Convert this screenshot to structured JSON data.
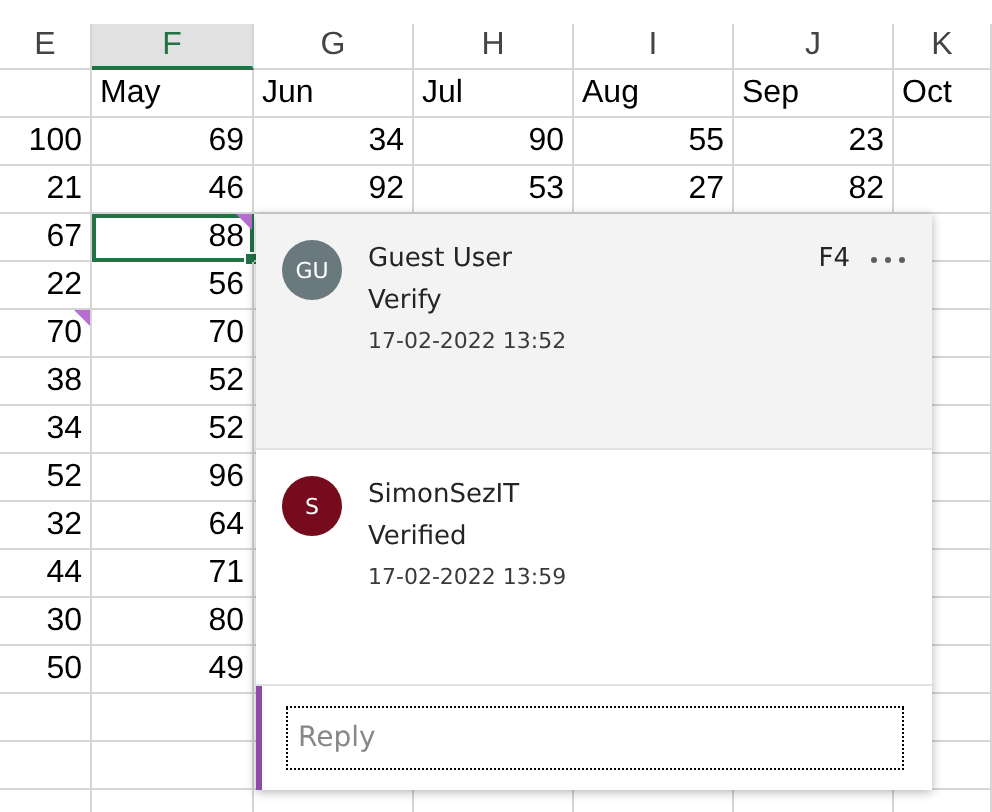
{
  "columns": [
    {
      "letter": "E",
      "selected": false
    },
    {
      "letter": "F",
      "selected": true
    },
    {
      "letter": "G",
      "selected": false
    },
    {
      "letter": "H",
      "selected": false
    },
    {
      "letter": "I",
      "selected": false
    },
    {
      "letter": "J",
      "selected": false
    },
    {
      "letter": "K",
      "selected": false
    }
  ],
  "rows": [
    {
      "kind": "header",
      "cells": [
        null,
        {
          "value": "May",
          "selected": false,
          "comment": false
        },
        {
          "value": "Jun",
          "selected": false,
          "comment": false
        },
        {
          "value": "Jul",
          "selected": false,
          "comment": false
        },
        {
          "value": "Aug",
          "selected": false,
          "comment": false
        },
        {
          "value": "Sep",
          "selected": false,
          "comment": false
        },
        {
          "value": "Oct",
          "selected": false,
          "comment": false
        }
      ]
    },
    {
      "kind": "data",
      "cells": [
        {
          "value": "100",
          "selected": false,
          "comment": false
        },
        {
          "value": "69",
          "selected": false,
          "comment": false
        },
        {
          "value": "34",
          "selected": false,
          "comment": false
        },
        {
          "value": "90",
          "selected": false,
          "comment": false
        },
        {
          "value": "55",
          "selected": false,
          "comment": false
        },
        {
          "value": "23",
          "selected": false,
          "comment": false
        }
      ]
    },
    {
      "kind": "data",
      "cells": [
        {
          "value": "21",
          "selected": false,
          "comment": false
        },
        {
          "value": "46",
          "selected": false,
          "comment": false
        },
        {
          "value": "92",
          "selected": false,
          "comment": false
        },
        {
          "value": "53",
          "selected": false,
          "comment": false
        },
        {
          "value": "27",
          "selected": false,
          "comment": false
        },
        {
          "value": "82",
          "selected": false,
          "comment": false
        }
      ]
    },
    {
      "kind": "data",
      "cells": [
        {
          "value": "67",
          "selected": false,
          "comment": false
        },
        {
          "value": "88",
          "selected": true,
          "comment": true
        }
      ]
    },
    {
      "kind": "data",
      "cells": [
        {
          "value": "22",
          "selected": false,
          "comment": false
        },
        {
          "value": "56",
          "selected": false,
          "comment": false
        }
      ]
    },
    {
      "kind": "data",
      "cells": [
        {
          "value": "70",
          "selected": false,
          "comment": true
        },
        {
          "value": "70",
          "selected": false,
          "comment": false
        }
      ]
    },
    {
      "kind": "data",
      "cells": [
        {
          "value": "38",
          "selected": false,
          "comment": false
        },
        {
          "value": "52",
          "selected": false,
          "comment": false
        }
      ]
    },
    {
      "kind": "data",
      "cells": [
        {
          "value": "34",
          "selected": false,
          "comment": false
        },
        {
          "value": "52",
          "selected": false,
          "comment": false
        }
      ]
    },
    {
      "kind": "data",
      "cells": [
        {
          "value": "52",
          "selected": false,
          "comment": false
        },
        {
          "value": "96",
          "selected": false,
          "comment": false
        }
      ]
    },
    {
      "kind": "data",
      "cells": [
        {
          "value": "32",
          "selected": false,
          "comment": false
        },
        {
          "value": "64",
          "selected": false,
          "comment": false
        }
      ]
    },
    {
      "kind": "data",
      "cells": [
        {
          "value": "44",
          "selected": false,
          "comment": false
        },
        {
          "value": "71",
          "selected": false,
          "comment": false
        }
      ]
    },
    {
      "kind": "data",
      "cells": [
        {
          "value": "30",
          "selected": false,
          "comment": false
        },
        {
          "value": "80",
          "selected": false,
          "comment": false
        }
      ]
    },
    {
      "kind": "data",
      "cells": [
        {
          "value": "50",
          "selected": false,
          "comment": false
        },
        {
          "value": "49",
          "selected": false,
          "comment": false
        }
      ]
    },
    {
      "kind": "data",
      "cells": []
    },
    {
      "kind": "data",
      "cells": []
    },
    {
      "kind": "data",
      "cells": []
    }
  ],
  "comment_thread": {
    "comments": [
      {
        "initials": "GU",
        "color": "#69797e",
        "author": "Guest User",
        "text": "Verify",
        "time": "17-02-2022 13:52",
        "cell": "F4",
        "highlighted": true
      },
      {
        "initials": "S",
        "color": "#750b1c",
        "author": "SimonSezIT",
        "text": "Verified",
        "time": "17-02-2022 13:59",
        "highlighted": false
      }
    ],
    "reply": {
      "placeholder": "Reply"
    }
  }
}
